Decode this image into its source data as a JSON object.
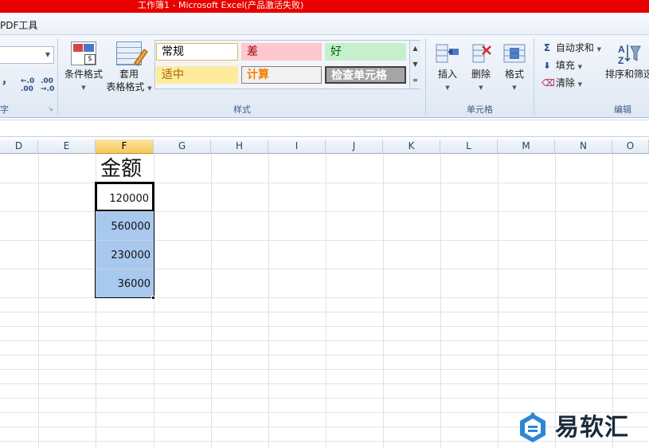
{
  "window": {
    "title": "工作簿1 - Microsoft Excel(产品激活失败)"
  },
  "menu": {
    "tabs": [
      "PDF工具"
    ]
  },
  "ribbon": {
    "number_group": {
      "comma": "，",
      "inc_decimal": "←.0\n.00",
      "dec_decimal": ".00\n→.0",
      "label_tail": "字"
    },
    "styles_group": {
      "label": "样式",
      "conditional_format": "条件格式",
      "format_as_table_line1": "套用",
      "format_as_table_line2": "表格格式",
      "gallery": [
        {
          "text": "常规",
          "bg": "#ffffff",
          "fg": "#000000",
          "border": "#e8b54a"
        },
        {
          "text": "差",
          "bg": "#ffc7ce",
          "fg": "#9c0006",
          "border": "#ffc7ce"
        },
        {
          "text": "好",
          "bg": "#c6efce",
          "fg": "#006100",
          "border": "#c6efce"
        },
        {
          "text": "适中",
          "bg": "#ffeb9c",
          "fg": "#9c6500",
          "border": "#ffeb9c"
        },
        {
          "text": "计算",
          "bg": "#f2f2f2",
          "fg": "#fa7d00",
          "border": "#7f7f7f"
        },
        {
          "text": "检查单元格",
          "bg": "#a5a5a5",
          "fg": "#ffffff",
          "border": "#3f3f3f"
        }
      ]
    },
    "cells_group": {
      "label": "单元格",
      "insert": "插入",
      "delete": "删除",
      "format": "格式"
    },
    "editing_group": {
      "label": "编辑",
      "autosum": "自动求和",
      "fill": "填充",
      "clear": "清除",
      "sort_filter": "排序和筛选"
    }
  },
  "grid": {
    "columns": [
      "D",
      "E",
      "F",
      "G",
      "H",
      "I",
      "J",
      "K",
      "L",
      "M",
      "N",
      "O"
    ],
    "selected_column": "F",
    "header_cell": "金额",
    "values": [
      "120000",
      "560000",
      "230000",
      "36000"
    ]
  },
  "watermark": {
    "text": "易软汇"
  }
}
